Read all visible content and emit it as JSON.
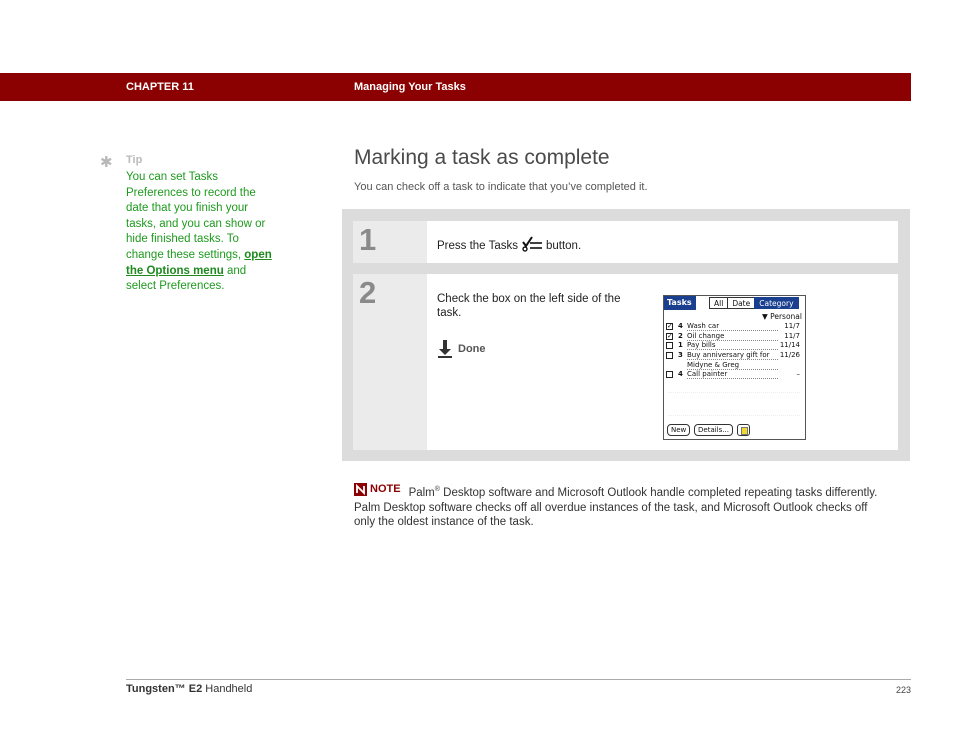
{
  "header": {
    "chapter": "CHAPTER 11",
    "chapter_title": "Managing Your Tasks"
  },
  "tip": {
    "label": "Tip",
    "text_before": "You can set Tasks Preferences to record the date that you finish your tasks, and you can show or hide finished tasks. To change these settings, ",
    "link": "open the Options menu",
    "text_after": " and select Preferences."
  },
  "section": {
    "title": "Marking a task as complete",
    "intro": "You can check off a task to indicate that you’ve completed it."
  },
  "steps": [
    {
      "number": "1",
      "text_before": "Press the Tasks",
      "icon": "tasks-button-icon",
      "text_after": "button."
    },
    {
      "number": "2",
      "text": "Check the box on the left side of the task.",
      "done_label": "Done"
    }
  ],
  "palm_screen": {
    "app_title": "Tasks",
    "tabs": [
      "All",
      "Date",
      "Category"
    ],
    "selected_tab": "Category",
    "category": "▼ Personal",
    "tasks": [
      {
        "checked": true,
        "priority": "4",
        "description": "Wash car",
        "due": "11/7"
      },
      {
        "checked": true,
        "priority": "2",
        "description": "Oil change",
        "due": "11/7"
      },
      {
        "checked": false,
        "priority": "1",
        "description": "Pay bills",
        "due": "11/14"
      },
      {
        "checked": false,
        "priority": "3",
        "description": "Buy anniversary gift for",
        "due": "11/26"
      },
      {
        "checked": null,
        "priority": "",
        "description": "Midyne & Greg",
        "due": ""
      },
      {
        "checked": false,
        "priority": "4",
        "description": "Call painter",
        "due": "–"
      }
    ],
    "buttons": {
      "new": "New",
      "details": "Details..."
    }
  },
  "note": {
    "label": "NOTE",
    "brand": "Palm",
    "reg": "®",
    "text": " Desktop software and Microsoft Outlook handle completed repeating tasks differently. Palm Desktop software checks off all overdue instances of the task, and Microsoft Outlook checks off only the oldest instance of the task."
  },
  "footer": {
    "product_bold": "Tungsten™ E2",
    "product_rest": " Handheld",
    "page": "223"
  },
  "colors": {
    "chapter_bar": "#8b0000",
    "tip_text": "#1e9a1e",
    "palm_highlight": "#1a3f8f"
  }
}
